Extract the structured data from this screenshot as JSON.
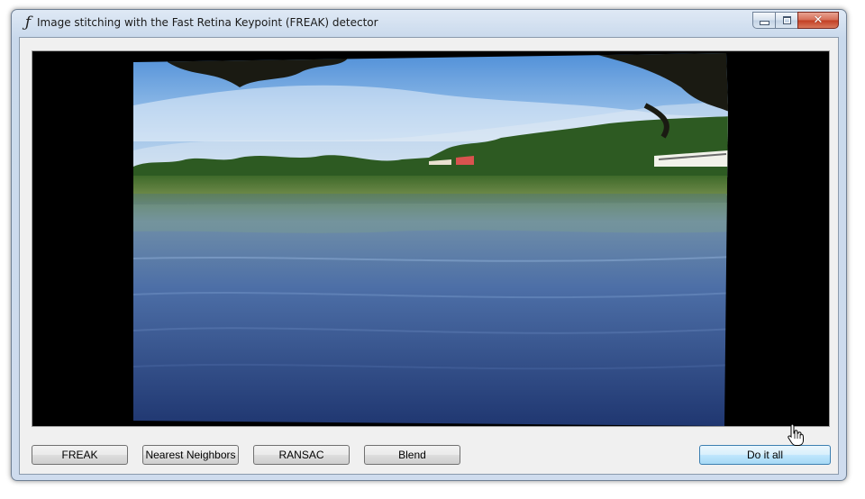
{
  "window": {
    "title": "Image stitching with the Fast Retina Keypoint (FREAK) detector",
    "icon": "function-f-icon",
    "controls": {
      "minimize": "minimize-icon",
      "maximize": "maximize-icon",
      "close": "✕"
    }
  },
  "main": {
    "image_description": "stitched-panorama-lake",
    "buttons": {
      "freak": "FREAK",
      "nearest_neighbors": "Nearest Neighbors",
      "ransac": "RANSAC",
      "blend": "Blend",
      "do_it_all": "Do it all"
    }
  },
  "colors": {
    "picture_background": "#000000",
    "hover_button": "#bee6fd",
    "close_button": "#c23d22"
  }
}
